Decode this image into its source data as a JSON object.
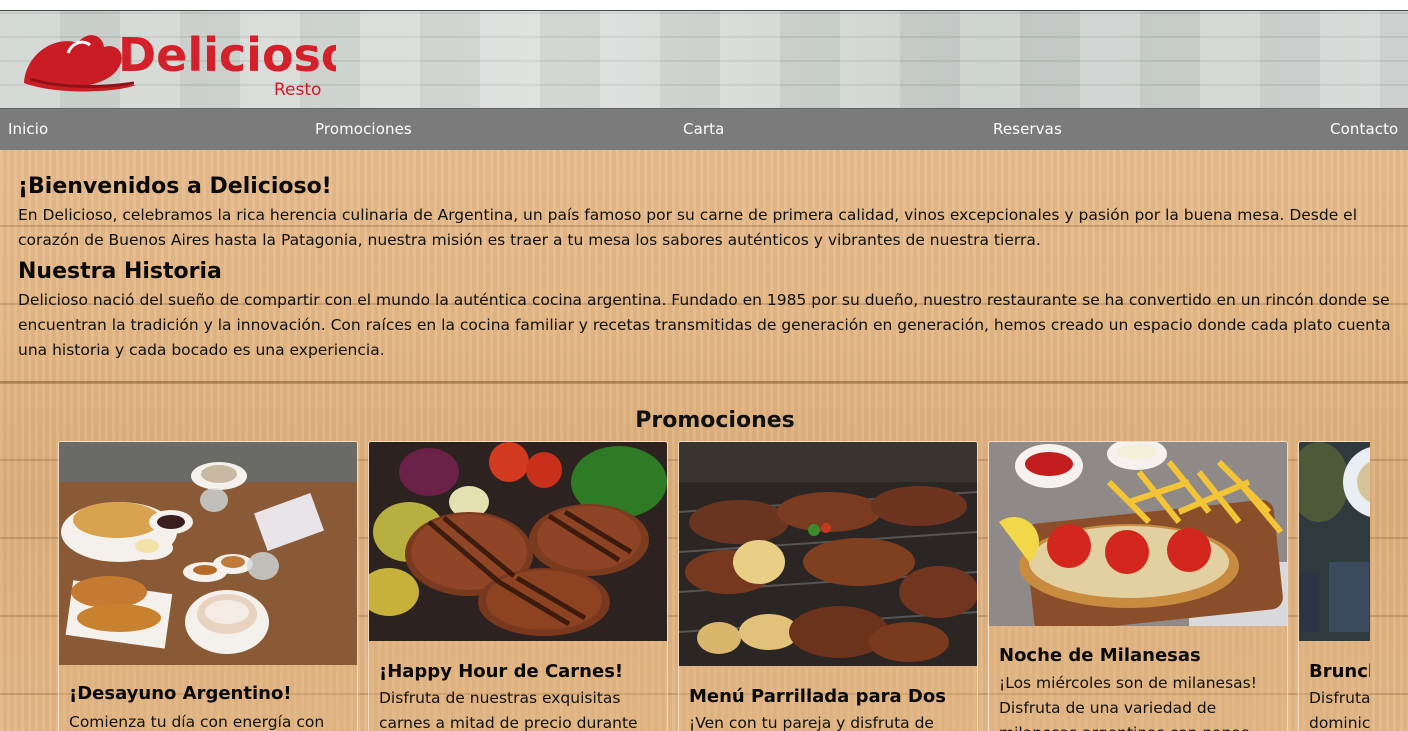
{
  "brand": {
    "name": "Delicioso",
    "tagline": "Resto",
    "accent_color": "#d4202a"
  },
  "nav": {
    "items": [
      {
        "label": "Inicio"
      },
      {
        "label": "Promociones"
      },
      {
        "label": "Carta"
      },
      {
        "label": "Reservas"
      },
      {
        "label": "Contacto"
      }
    ]
  },
  "welcome": {
    "title": "¡Bienvenidos a Delicioso!",
    "text": "En Delicioso, celebramos la rica herencia culinaria de Argentina, un país famoso por su carne de primera calidad, vinos excepcionales y pasión por la buena mesa. Desde el corazón de Buenos Aires hasta la Patagonia, nuestra misión es traer a tu mesa los sabores auténticos y vibrantes de nuestra tierra."
  },
  "history": {
    "title": "Nuestra Historia",
    "text": "Delicioso nació del sueño de compartir con el mundo la auténtica cocina argentina. Fundado en 1985 por su dueño, nuestro restaurante se ha convertido en un rincón donde se encuentran la tradición y la innovación. Con raíces en la cocina familiar y recetas transmitidas de generación en generación, hemos creado un espacio donde cada plato cuenta una historia y cada bocado es una experiencia."
  },
  "promotions": {
    "title": "Promociones",
    "cards": [
      {
        "title": "¡Desayuno Argentino!",
        "text": "Comienza tu día con energía con",
        "image": "breakfast-photo"
      },
      {
        "title": "¡Happy Hour de Carnes!",
        "text": "Disfruta de nuestras exquisitas carnes a mitad de precio durante",
        "image": "grilled-steaks-photo"
      },
      {
        "title": "Menú Parrillada para Dos",
        "text": "¡Ven con tu pareja y disfruta de",
        "image": "parrillada-grill-photo"
      },
      {
        "title": "Noche de Milanesas",
        "text": "¡Los miércoles son de milanesas! Disfruta de una variedad de milanesas argentinas con papas",
        "image": "milanesa-photo"
      },
      {
        "title": "Brunch",
        "text": "Disfruta dominic",
        "image": "brunch-photo"
      }
    ]
  }
}
